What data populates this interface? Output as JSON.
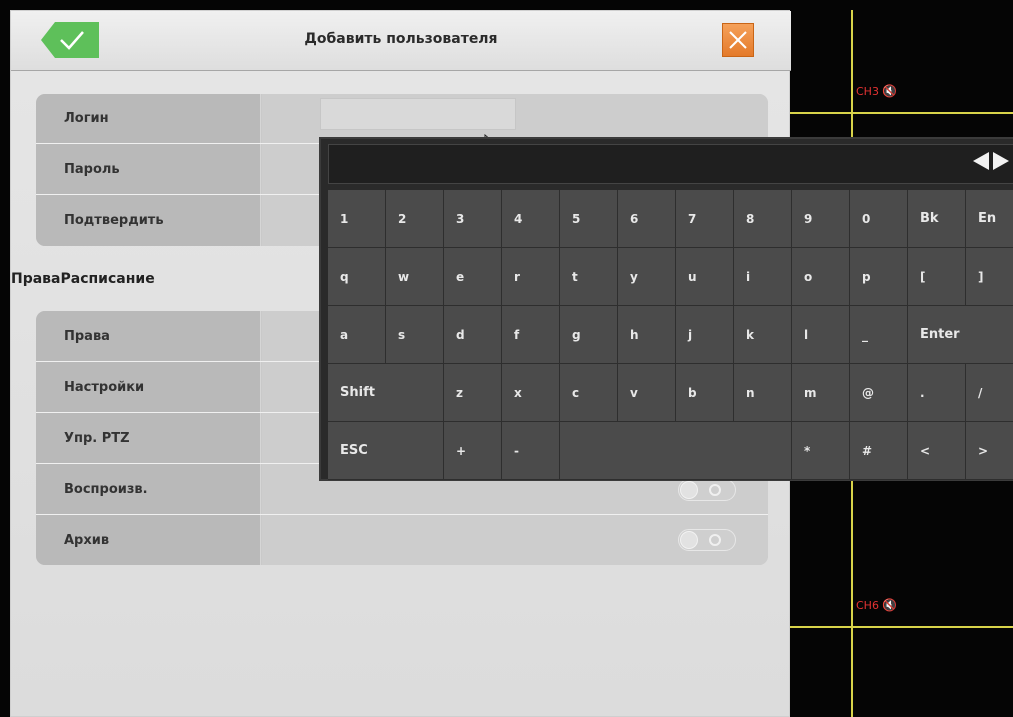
{
  "dialog": {
    "title": "Добавить пользователя",
    "colors": {
      "confirm": "#5ec05a",
      "close": "#ea8434"
    }
  },
  "fields": [
    {
      "label": "Логин",
      "value": ""
    },
    {
      "label": "Пароль"
    },
    {
      "label": "Подтвердить"
    }
  ],
  "tab": {
    "label": "ПраваРасписание"
  },
  "rights": [
    {
      "label": "Права"
    },
    {
      "label": "Настройки"
    },
    {
      "label": "Упр. PTZ"
    },
    {
      "label": "Воспроизв.",
      "enabled": false
    },
    {
      "label": "Архив",
      "enabled": false
    }
  ],
  "keyboard": {
    "rows": [
      [
        "1",
        "2",
        "3",
        "4",
        "5",
        "6",
        "7",
        "8",
        "9",
        "0",
        "Bk",
        "En"
      ],
      [
        "q",
        "w",
        "e",
        "r",
        "t",
        "y",
        "u",
        "i",
        "o",
        "p",
        "[",
        "]"
      ],
      [
        "a",
        "s",
        "d",
        "f",
        "g",
        "h",
        "j",
        "k",
        "l",
        "_",
        "Enter"
      ],
      [
        "Shift",
        "z",
        "x",
        "c",
        "v",
        "b",
        "n",
        "m",
        "@",
        ".",
        "/"
      ],
      [
        "ESC",
        "+",
        "-",
        "",
        "*",
        "#",
        "<",
        ">"
      ]
    ]
  },
  "cameras": [
    {
      "label": "CH3"
    },
    {
      "label": "CH6"
    }
  ]
}
